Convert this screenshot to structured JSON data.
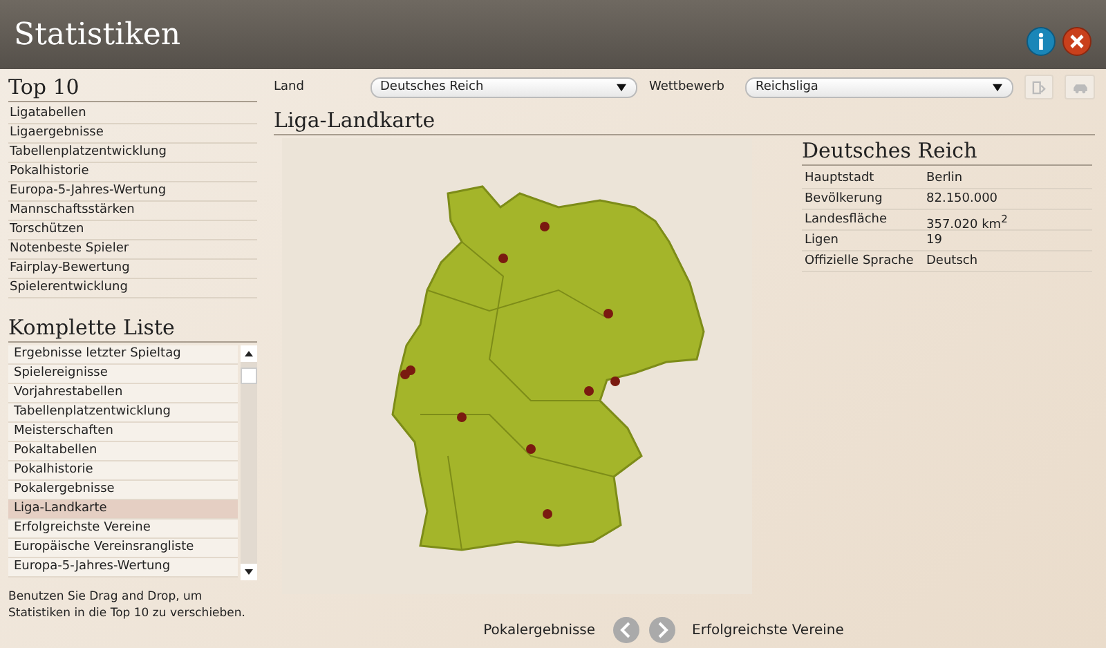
{
  "window": {
    "title": "Statistiken"
  },
  "top10": {
    "title": "Top 10",
    "items": [
      "Ligatabellen",
      "Ligaergebnisse",
      "Tabellenplatzentwicklung",
      "Pokalhistorie",
      "Europa-5-Jahres-Wertung",
      "Mannschaftsstärken",
      "Torschützen",
      "Notenbeste Spieler",
      "Fairplay-Bewertung",
      "Spielerentwicklung"
    ]
  },
  "full_list": {
    "title": "Komplette Liste",
    "items": [
      {
        "label": "Ergebnisse letzter Spieltag",
        "selected": false
      },
      {
        "label": "Spielereignisse",
        "selected": false
      },
      {
        "label": "Vorjahrestabellen",
        "selected": false
      },
      {
        "label": "Tabellenplatzentwicklung",
        "selected": false
      },
      {
        "label": "Meisterschaften",
        "selected": false
      },
      {
        "label": "Pokaltabellen",
        "selected": false
      },
      {
        "label": "Pokalhistorie",
        "selected": false
      },
      {
        "label": "Pokalergebnisse",
        "selected": false
      },
      {
        "label": "Liga-Landkarte",
        "selected": true
      },
      {
        "label": "Erfolgreichste Vereine",
        "selected": false
      },
      {
        "label": "Europäische Vereinsrangliste",
        "selected": false
      },
      {
        "label": "Europa-5-Jahres-Wertung",
        "selected": false
      }
    ],
    "hint": "Benutzen Sie Drag and Drop, um Statistiken in die Top 10 zu verschieben."
  },
  "filters": [
    {
      "label": "Land",
      "value": "Deutsches Reich"
    },
    {
      "label": "Wettbewerb",
      "value": "Reichsliga"
    }
  ],
  "section_title": "Liga-Landkarte",
  "country": {
    "title": "Deutsches Reich",
    "rows": [
      {
        "label": "Hauptstadt",
        "value": "Berlin"
      },
      {
        "label": "Bevölkerung",
        "value": "82.150.000"
      },
      {
        "label": "Landesfläche",
        "value": "357.020 km$^{2}$"
      },
      {
        "label": "Ligen",
        "value": "19"
      },
      {
        "label": "Offizielle Sprache",
        "value": "Deutsch"
      }
    ]
  },
  "navigation": {
    "previous": "Pokalergebnisse",
    "next": "Erfolgreichste Vereine"
  }
}
